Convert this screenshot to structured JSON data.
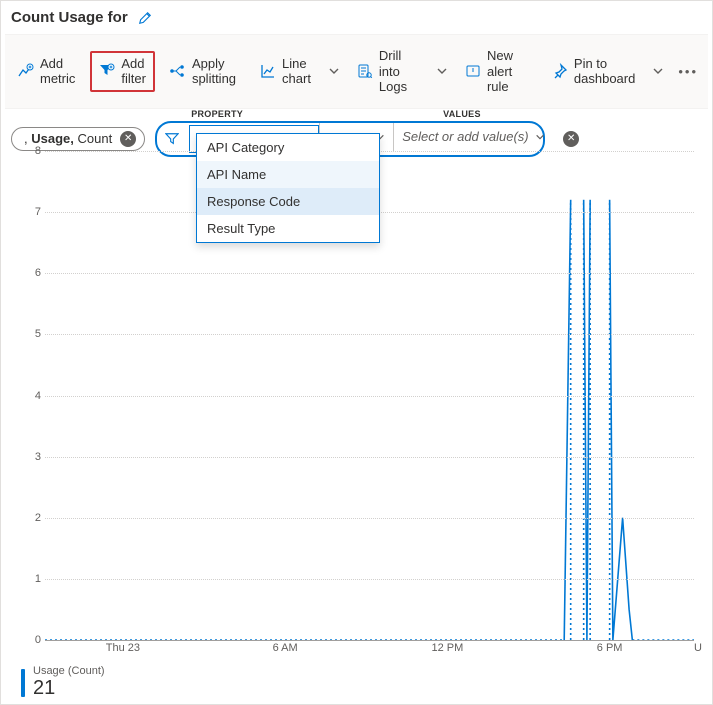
{
  "title": "Count Usage for",
  "toolbar": {
    "add_metric": "Add metric",
    "add_filter": "Add filter",
    "apply_splitting": "Apply splitting",
    "line_chart": "Line chart",
    "drill_logs": "Drill into Logs",
    "new_alert": "New alert rule",
    "pin_dash": "Pin to dashboard"
  },
  "metric_pill": {
    "prefix": ", ",
    "metric": "Usage,",
    "agg": " Count"
  },
  "filter": {
    "label_property": "PROPERTY",
    "label_values": "VALUES",
    "property_value": "Response Code",
    "operator": "=",
    "values_placeholder": "Select or add value(s)"
  },
  "dropdown": {
    "items": [
      "API Category",
      "API Name",
      "Response Code",
      "Result Type"
    ],
    "hover_index": 1,
    "selected_index": 2
  },
  "chart_data": {
    "type": "line",
    "ylim": [
      0,
      8
    ],
    "yticks": [
      0,
      1,
      2,
      3,
      4,
      5,
      6,
      7,
      8
    ],
    "xlabels": [
      {
        "pos": 0.12,
        "text": "Thu 23"
      },
      {
        "pos": 0.37,
        "text": "6 AM"
      },
      {
        "pos": 0.62,
        "text": "12 PM"
      },
      {
        "pos": 0.87,
        "text": "6 PM"
      },
      {
        "pos": 1.0,
        "text": "U",
        "right": true
      }
    ],
    "series": [
      {
        "name": "Usage (Count)",
        "color": "#0078d4",
        "segments": [
          {
            "style": "dotted",
            "points": [
              [
                0.0,
                0
              ],
              [
                0.8,
                0
              ]
            ]
          },
          {
            "style": "solid",
            "points": [
              [
                0.8,
                0
              ],
              [
                0.81,
                7.2
              ]
            ]
          },
          {
            "style": "solid",
            "points": [
              [
                0.83,
                7.2
              ],
              [
                0.835,
                0
              ],
              [
                0.84,
                7.2
              ]
            ]
          },
          {
            "style": "solid",
            "points": [
              [
                0.87,
                7.2
              ],
              [
                0.875,
                0
              ],
              [
                0.89,
                2.0
              ],
              [
                0.9,
                0.5
              ],
              [
                0.905,
                0
              ]
            ]
          },
          {
            "style": "dotted",
            "points": [
              [
                0.81,
                0
              ],
              [
                0.81,
                7.2
              ]
            ]
          },
          {
            "style": "dotted",
            "points": [
              [
                0.83,
                0
              ],
              [
                0.83,
                7.2
              ]
            ]
          },
          {
            "style": "dotted",
            "points": [
              [
                0.84,
                0
              ],
              [
                0.84,
                7.2
              ]
            ]
          },
          {
            "style": "dotted",
            "points": [
              [
                0.87,
                0
              ],
              [
                0.87,
                7.2
              ]
            ]
          },
          {
            "style": "dotted",
            "points": [
              [
                0.905,
                0
              ],
              [
                1.0,
                0
              ]
            ]
          }
        ]
      }
    ]
  },
  "legend": {
    "label": "Usage (Count)",
    "value": "21"
  }
}
